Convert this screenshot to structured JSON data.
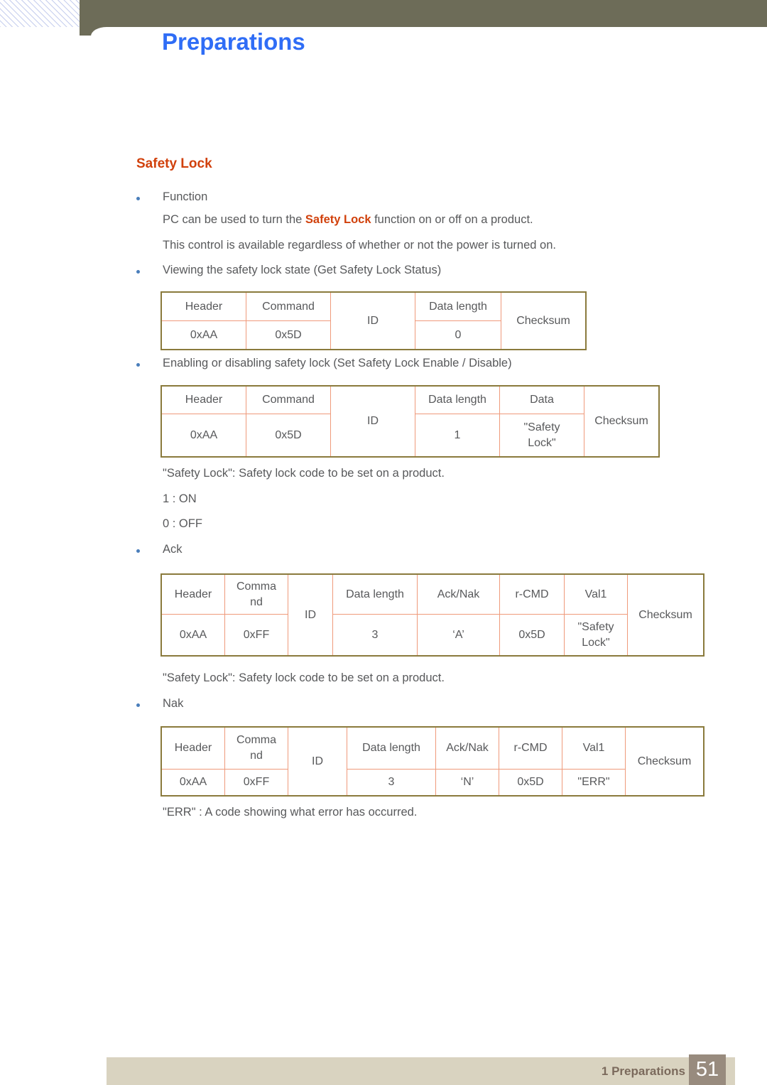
{
  "header": {
    "title": "Preparations"
  },
  "section": {
    "heading": "Safety Lock"
  },
  "body": {
    "bullet_function": "Function",
    "para_pc_prefix": "PC can be used to turn the ",
    "para_pc_highlight": "Safety Lock",
    "para_pc_suffix": " function on or off on a product.",
    "para_control": "This control is available regardless of whether or not the power is turned on.",
    "bullet_viewing": "Viewing the safety lock state (Get Safety Lock Status)",
    "bullet_enabling": "Enabling or disabling safety lock (Set Safety Lock Enable / Disable)",
    "note_safety_lock_1": "\"Safety Lock\": Safety lock code to be set on a product.",
    "note_on": "1 : ON",
    "note_off": "0 : OFF",
    "bullet_ack": "Ack",
    "note_safety_lock_2": "\"Safety Lock\": Safety lock code to be set on a product.",
    "bullet_nak": "Nak",
    "note_err": "\"ERR\" : A code showing what error has occurred."
  },
  "tables": {
    "get_status": {
      "headers": [
        "Header",
        "Command",
        "ID",
        "Data length",
        "Checksum"
      ],
      "values": [
        "0xAA",
        "0x5D",
        "0"
      ]
    },
    "set_enable_disable": {
      "headers": [
        "Header",
        "Command",
        "ID",
        "Data length",
        "Data",
        "Checksum"
      ],
      "values": [
        "0xAA",
        "0x5D",
        "1"
      ],
      "data_line1": "\"Safety",
      "data_line2": "Lock\""
    },
    "ack": {
      "header_line1": "Header",
      "command_line1": "Comma",
      "command_line2": "nd",
      "id": "ID",
      "data_length": "Data length",
      "ack_nak": "Ack/Nak",
      "r_cmd": "r-CMD",
      "val1": "Val1",
      "checksum": "Checksum",
      "v_header": "0xAA",
      "v_command": "0xFF",
      "v_data_length": "3",
      "v_ack_nak": "‘A’",
      "v_r_cmd": "0x5D",
      "v_val1_line1": "\"Safety",
      "v_val1_line2": "Lock\""
    },
    "nak": {
      "header_line1": "Header",
      "command_line1": "Comma",
      "command_line2": "nd",
      "id": "ID",
      "data_length": "Data length",
      "ack_nak": "Ack/Nak",
      "r_cmd": "r-CMD",
      "val1": "Val1",
      "checksum": "Checksum",
      "v_header": "0xAA",
      "v_command": "0xFF",
      "v_data_length": "3",
      "v_ack_nak": "‘N’",
      "v_r_cmd": "0x5D",
      "v_val1": "\"ERR\""
    }
  },
  "footer": {
    "label": "1 Preparations",
    "page_number": "51"
  },
  "colors": {
    "title_blue": "#2f6df6",
    "heading_orange": "#d1410c",
    "header_band_olive": "#6d6c58",
    "table_outer_border": "#8a7a3c",
    "table_inner_border": "#ef9a7b",
    "footer_bar": "#d9d3c0",
    "page_number_box": "#988b7e",
    "bullet_blue": "#4a7ebb",
    "body_text": "#58595b"
  }
}
